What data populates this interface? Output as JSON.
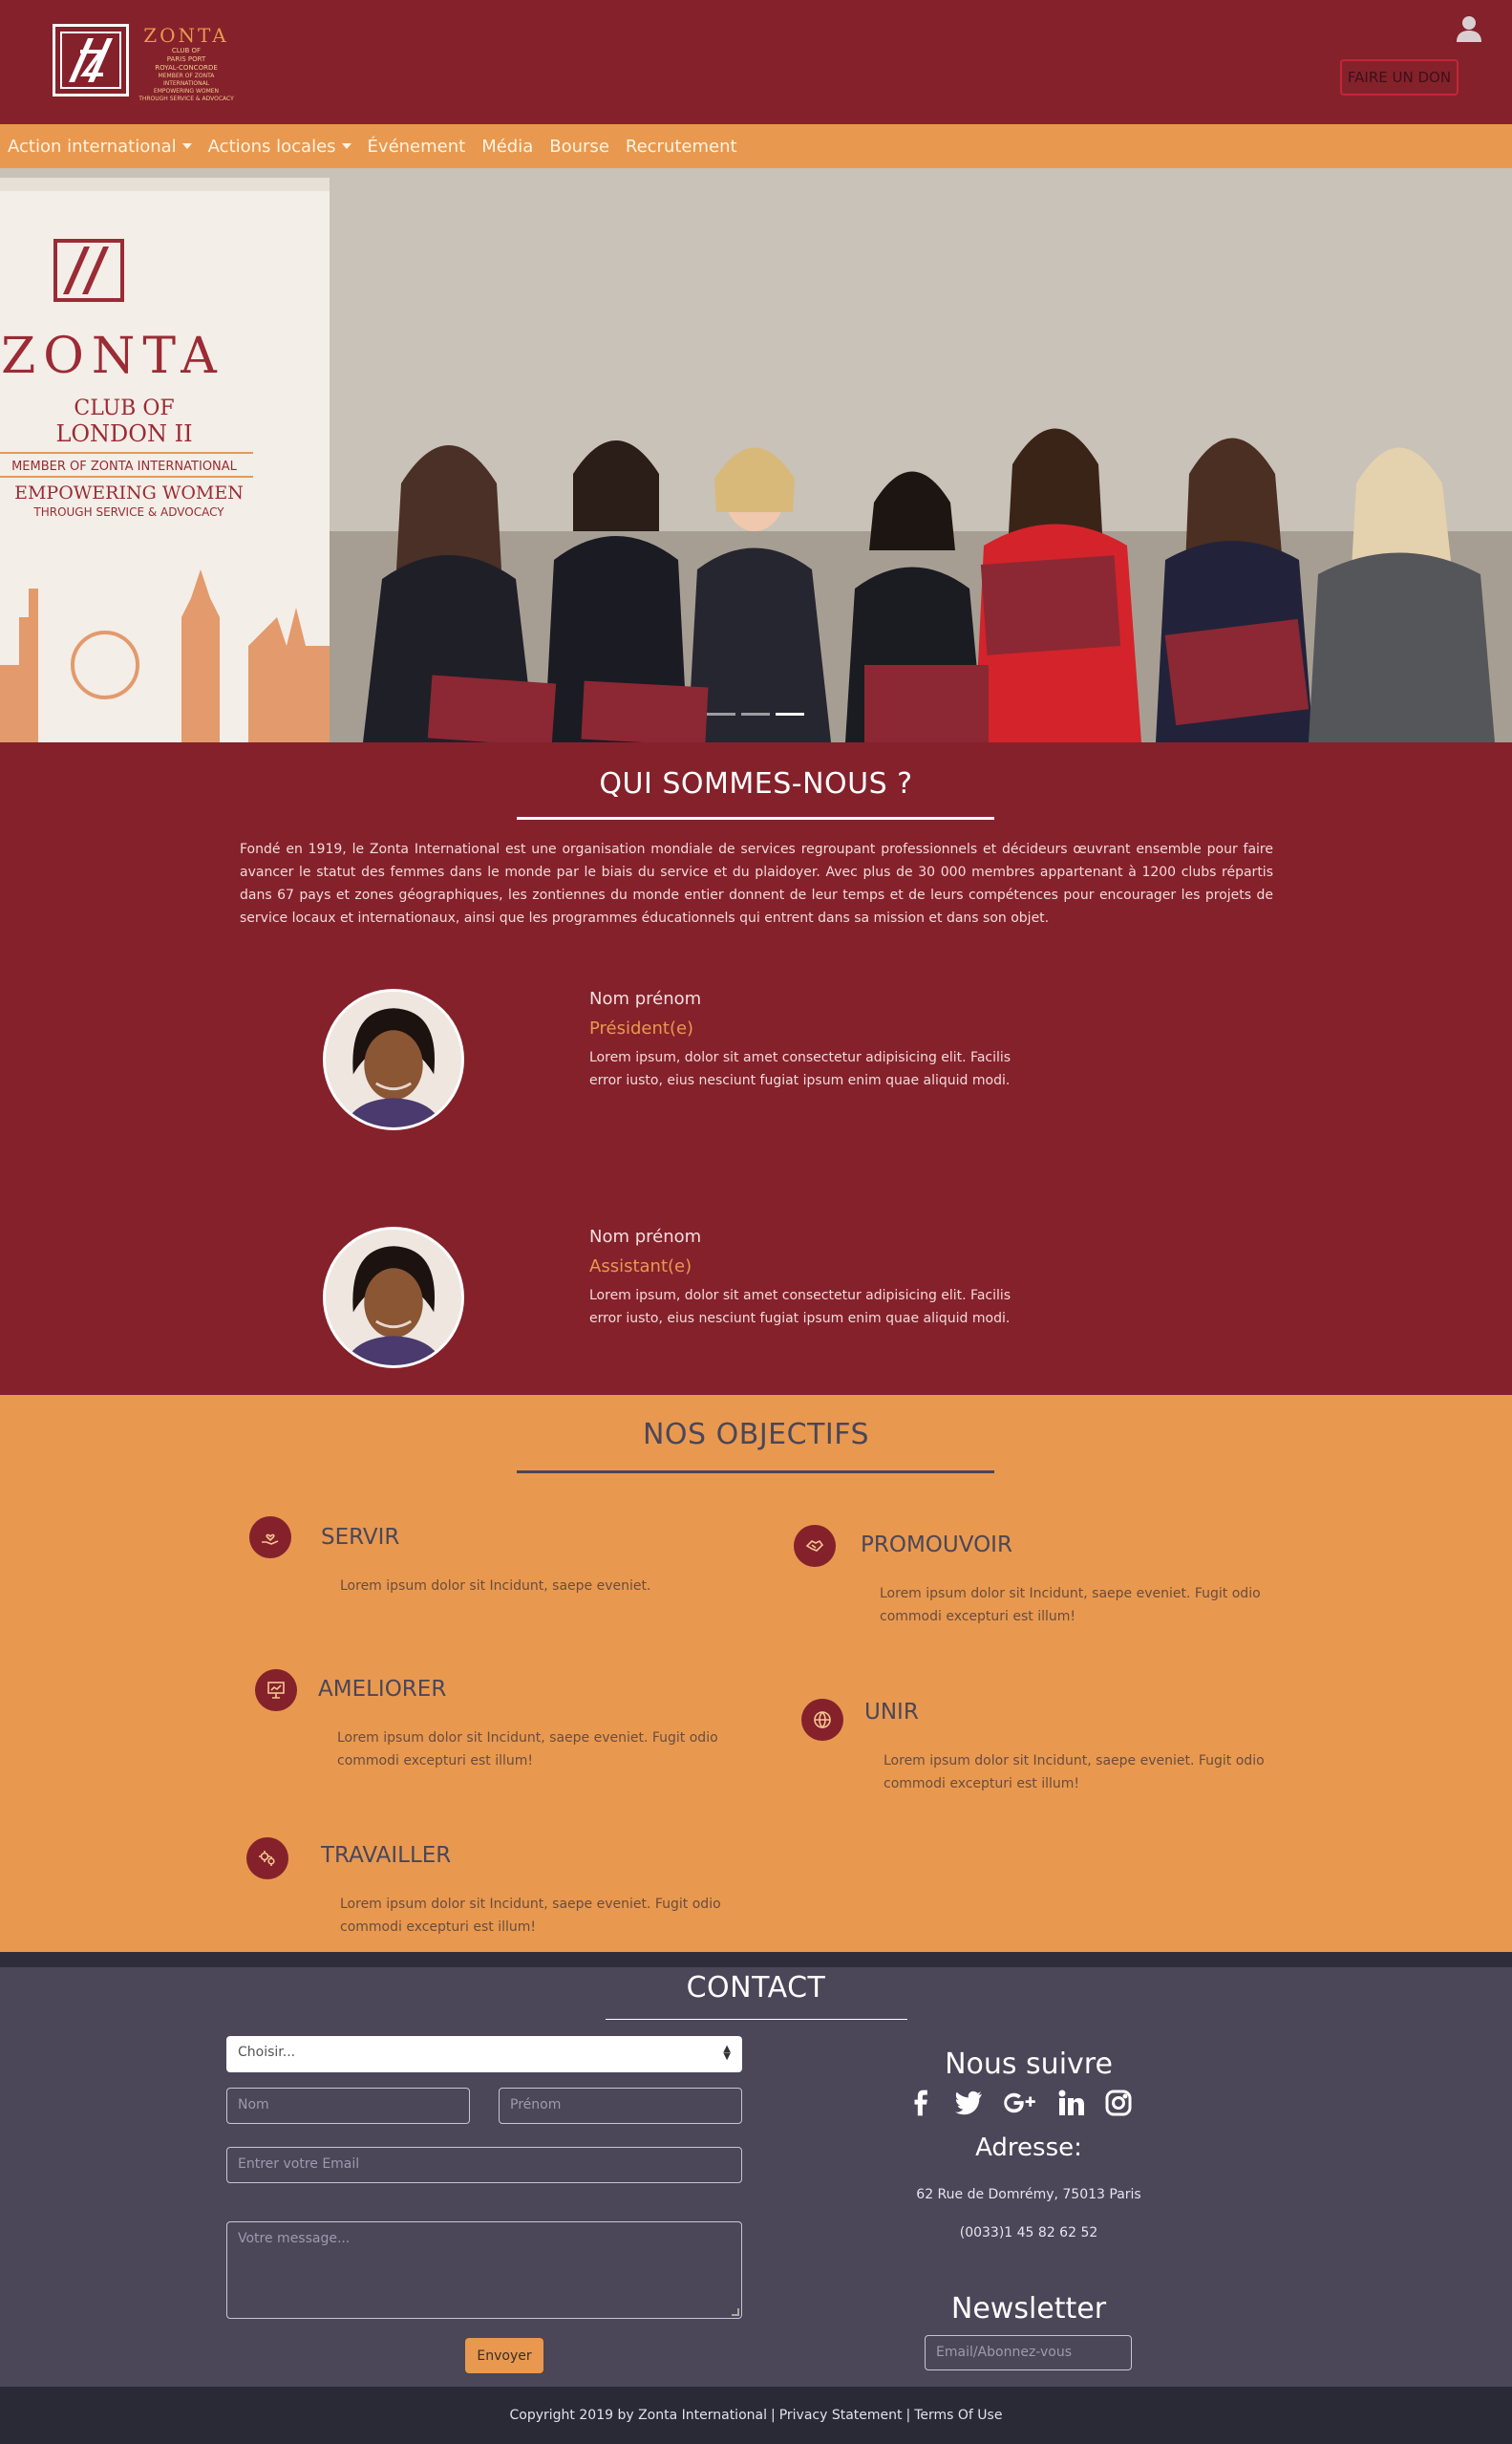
{
  "header": {
    "logo": {
      "brand": "ZONTA",
      "club_lines": [
        "CLUB OF",
        "PARIS PORT",
        "ROYAL-CONCORDE"
      ],
      "tagline_lines": [
        "MEMBER OF ZONTA INTERNATIONAL",
        "EMPOWERING WOMEN",
        "THROUGH SERVICE & ADVOCACY"
      ]
    },
    "user_icon": "user-icon",
    "donate_label": "FAIRE UN DON"
  },
  "nav": {
    "items": [
      {
        "label": "Action international",
        "dropdown": true
      },
      {
        "label": "Actions locales",
        "dropdown": true
      },
      {
        "label": "Événement",
        "dropdown": false
      },
      {
        "label": "Média",
        "dropdown": false
      },
      {
        "label": "Bourse",
        "dropdown": false
      },
      {
        "label": "Recrutement",
        "dropdown": false
      }
    ]
  },
  "hero": {
    "banner_brand": "ZONTA",
    "banner_club": "CLUB OF",
    "banner_city": "LONDON II",
    "banner_member": "MEMBER OF ZONTA INTERNATIONAL",
    "banner_empower": "EMPOWERING WOMEN",
    "banner_advocacy": "THROUGH SERVICE & ADVOCACY",
    "slides": 3,
    "active_slide": 3
  },
  "about": {
    "title": "QUI SOMMES-NOUS ?",
    "text": "Fondé en 1919, le Zonta International est une organisation mondiale de services regroupant professionnels et décideurs œuvrant ensemble pour faire avancer le statut des femmes dans le monde par le biais du service et du plaidoyer. Avec plus de 30 000 membres appartenant à 1200 clubs répartis dans 67 pays et zones géographiques, les zontiennes du monde entier donnent de leur temps et de leurs compétences pour encourager les projets de service locaux et internationaux, ainsi que les programmes éducationnels qui entrent dans sa mission et dans son objet.",
    "members": [
      {
        "name": "Nom prénom",
        "role": "Président(e)",
        "desc": "Lorem ipsum, dolor sit amet consectetur adipisicing elit. Facilis error iusto, eius nesciunt fugiat ipsum enim quae aliquid modi."
      },
      {
        "name": "Nom prénom",
        "role": "Assistant(e)",
        "desc": "Lorem ipsum, dolor sit amet consectetur adipisicing elit. Facilis error iusto, eius nesciunt fugiat ipsum enim quae aliquid modi."
      }
    ]
  },
  "objectives": {
    "title": "NOS OBJECTIFS",
    "items": [
      {
        "title": "SERVIR",
        "desc": "Lorem ipsum dolor sit Incidunt, saepe eveniet.",
        "icon": "hand-heart-icon"
      },
      {
        "title": "PROMOUVOIR",
        "desc": "Lorem ipsum dolor sit Incidunt, saepe eveniet. Fugit odio commodi excepturi est illum!",
        "icon": "handshake-icon"
      },
      {
        "title": "AMELIORER",
        "desc": "Lorem ipsum dolor sit Incidunt, saepe eveniet. Fugit odio commodi excepturi est illum!",
        "icon": "presentation-icon"
      },
      {
        "title": "UNIR",
        "desc": "Lorem ipsum dolor sit Incidunt, saepe eveniet. Fugit odio commodi excepturi est illum!",
        "icon": "globe-icon"
      },
      {
        "title": "TRAVAILLER",
        "desc": "Lorem ipsum dolor sit Incidunt, saepe eveniet. Fugit odio commodi excepturi est illum!",
        "icon": "gears-icon"
      }
    ]
  },
  "contact": {
    "title": "CONTACT",
    "select_value": "Choisir...",
    "nom_placeholder": "Nom",
    "prenom_placeholder": "Prénom",
    "email_placeholder": "Entrer votre Email",
    "message_placeholder": "Votre message...",
    "send_label": "Envoyer",
    "follow_title": "Nous suivre",
    "social": [
      "facebook-icon",
      "twitter-icon",
      "google-plus-icon",
      "linkedin-icon",
      "instagram-icon"
    ],
    "address_title": "Adresse:",
    "address": "62 Rue de Domrémy, 75013 Paris",
    "phone": "(0033)1 45 82 62 52",
    "newsletter_title": "Newsletter",
    "newsletter_placeholder": "Email/Abonnez-vous"
  },
  "footer": {
    "copyright": "Copyright 2019 by Zonta International",
    "sep": "|",
    "privacy": "Privacy Statement",
    "terms": "Terms Of Use"
  },
  "colors": {
    "brand_red": "#85212b",
    "accent_orange": "#e8994f",
    "dark_slate": "#4b4658",
    "footer_dark": "#2a2936"
  }
}
